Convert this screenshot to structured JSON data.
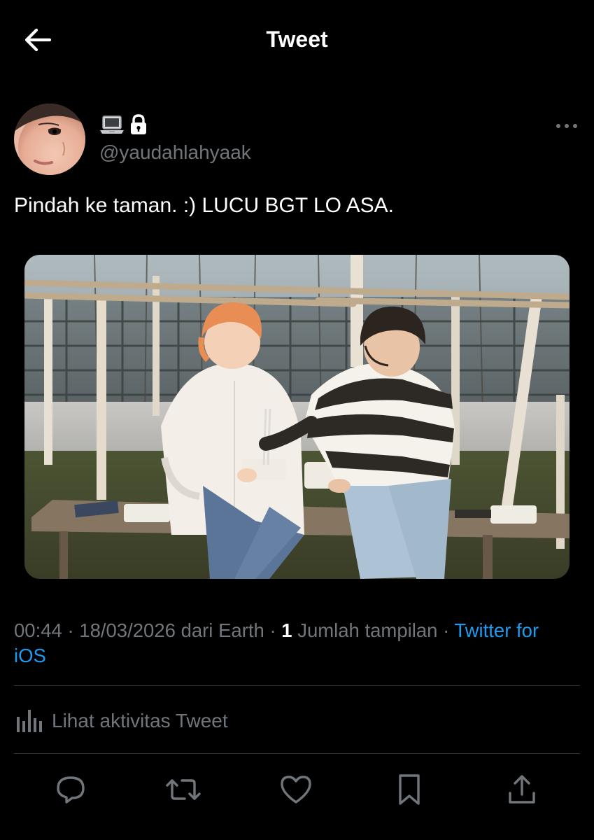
{
  "header": {
    "title": "Tweet",
    "back_icon": "arrow-left-icon"
  },
  "author": {
    "display_name_icons": [
      "laptop-emoji",
      "lock-icon"
    ],
    "handle": "@yaudahlahyaak",
    "more_icon": "more-dots-icon"
  },
  "tweet": {
    "text": "Pindah ke taman. :) LUCU BGT LO ASA.",
    "media": {
      "type": "photo",
      "description_icon": "photo"
    }
  },
  "meta": {
    "time": "00:44",
    "date": "18/03/2026",
    "location_prefix": "dari",
    "location": "Earth",
    "views_count": "1",
    "views_label": "Jumlah tampilan",
    "source": "Twitter for iOS",
    "separator": "·"
  },
  "activity": {
    "label": "Lihat aktivitas Tweet",
    "icon": "analytics-bars-icon"
  },
  "actions": [
    {
      "name": "reply",
      "icon": "reply-bubble-icon"
    },
    {
      "name": "retweet",
      "icon": "retweet-icon"
    },
    {
      "name": "like",
      "icon": "heart-icon"
    },
    {
      "name": "bookmark",
      "icon": "bookmark-icon"
    },
    {
      "name": "share",
      "icon": "share-upload-icon"
    }
  ],
  "colors": {
    "background": "#000000",
    "text_primary": "#ffffff",
    "text_secondary": "#71767b",
    "link": "#1d9bf0",
    "divider": "#2f3336"
  }
}
